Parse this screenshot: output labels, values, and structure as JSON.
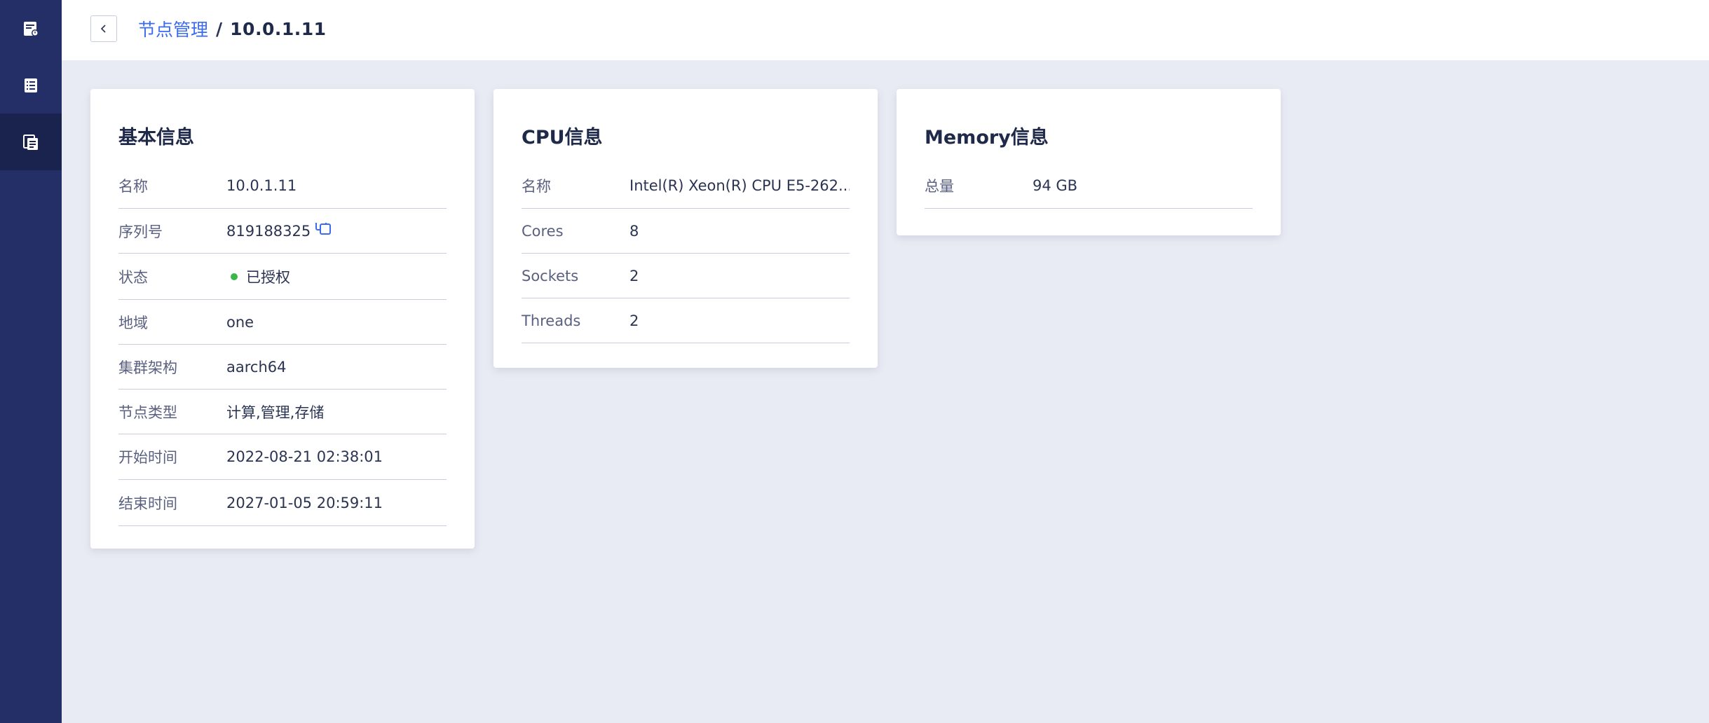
{
  "sidebar": {
    "items": [
      {
        "icon": "report-icon"
      },
      {
        "icon": "list-icon"
      },
      {
        "icon": "nodes-icon",
        "active": true
      }
    ]
  },
  "breadcrumb": {
    "parent": "节点管理",
    "separator": "/",
    "current": "10.0.1.11"
  },
  "basic": {
    "title": "基本信息",
    "name": {
      "label": "名称",
      "value": "10.0.1.11"
    },
    "serial": {
      "label": "序列号",
      "value": "819188325"
    },
    "status": {
      "label": "状态",
      "value": "已授权",
      "color": "#3cb54a"
    },
    "region": {
      "label": "地域",
      "value": "one"
    },
    "arch": {
      "label": "集群架构",
      "value": "aarch64"
    },
    "node_type": {
      "label": "节点类型",
      "value": "计算,管理,存储"
    },
    "start_time": {
      "label": "开始时间",
      "value": "2022-08-21 02:38:01"
    },
    "end_time": {
      "label": "结束时间",
      "value": "2027-01-05 20:59:11"
    }
  },
  "cpu": {
    "title": "CPU信息",
    "name": {
      "label": "名称",
      "value": "Intel(R) Xeon(R) CPU E5-262..."
    },
    "cores": {
      "label": "Cores",
      "value": "8"
    },
    "sockets": {
      "label": "Sockets",
      "value": "2"
    },
    "threads": {
      "label": "Threads",
      "value": "2"
    }
  },
  "memory": {
    "title": "Memory信息",
    "total": {
      "label": "总量",
      "value": "94 GB"
    }
  },
  "colors": {
    "sidebar": "#232f66",
    "accent": "#3b6bf0",
    "background": "#e9ebf4"
  }
}
